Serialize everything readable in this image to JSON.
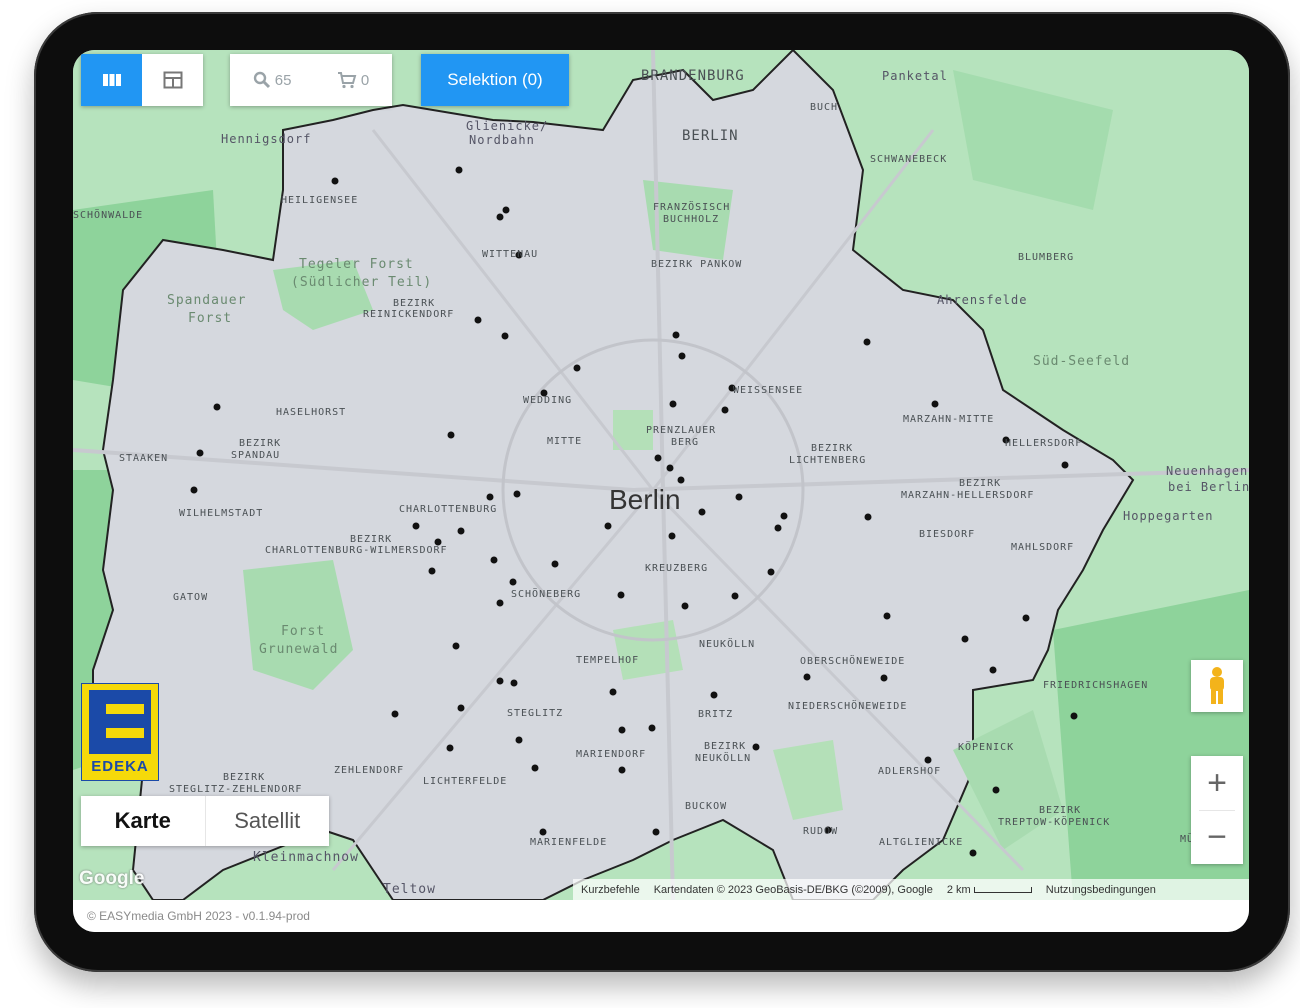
{
  "toolbar": {
    "search_count": "65",
    "cart_count": "0",
    "selection_label": "Selektion (0)"
  },
  "map": {
    "city_label": "Berlin",
    "labels": [
      "BRANDENBURG",
      "Panketal",
      "BERLIN",
      "Glienicke/ Nordbahn",
      "BUCH",
      "Hennigsdorf",
      "SCHWANEBECK",
      "HEILIGENSEE",
      "SCHÖNWALDE",
      "FRANZÖSISCH BUCHHOLZ",
      "BLUMBERG",
      "WITTENAU",
      "BEZIRK PANKOW",
      "Tegeler Forst (Südlicher Teil)",
      "Spandauer Forst",
      "BEZIRK REINICKENDORF",
      "Ahrensfelde",
      "Süd-Seefeld",
      "WEISSENSEE",
      "WEDDING",
      "HASELHORST",
      "MARZAHN-MITTE",
      "MITTE",
      "PRENZLAUER BERG",
      "BEZIRK SPANDAU",
      "STAAKEN",
      "HELLERSDORF",
      "BEZIRK LICHTENBERG",
      "Neuenhagen bei Berlin",
      "BEZIRK MARZAHN-HELLERSDORF",
      "WILHELMSTADT",
      "CHARLOTTENBURG",
      "Hoppegarten",
      "BIESDORF",
      "BEZIRK CHARLOTTENBURG-WILMERSDORF",
      "MAHLSDORF",
      "KREUZBERG",
      "GATOW",
      "SCHÖNEBERG",
      "Forst Grunewald",
      "NEUKÖLLN",
      "TEMPELHOF",
      "OBERSCHÖNEWEIDE",
      "FRIEDRICHSHAGEN",
      "STEGLITZ",
      "BRITZ",
      "NIEDERSCHÖNEWEIDE",
      "MARIENDORF",
      "BEZIRK NEUKÖLLN",
      "KÖPENICK",
      "BEZIRK STEGLITZ-ZEHLENDORF",
      "ZEHLENDORF",
      "ADLERSHOF",
      "LICHTERFELDE",
      "BUCKOW",
      "BEZIRK TREPTOW-KÖPENICK",
      "MÜGGELH",
      "RUDOW",
      "Kleinmachnow",
      "MARIENFELDE",
      "ALTGLIENICKE",
      "Teltow"
    ],
    "attribution": {
      "shortcuts": "Kurzbefehle",
      "data": "Kartendaten © 2023 GeoBasis-DE/BKG (©2009), Google",
      "scale": "2 km",
      "terms": "Nutzungsbedingungen"
    },
    "google_logo": "Google"
  },
  "map_type": {
    "options": [
      "Karte",
      "Satellit"
    ],
    "selected": "Karte"
  },
  "zoom": {
    "in": "+",
    "out": "−"
  },
  "logo": {
    "word": "EDEKA"
  },
  "footer": {
    "text": "© EASYmedia GmbH 2023 - v0.1.94-prod"
  },
  "colors": {
    "accent": "#2196f3",
    "edeka_yellow": "#f5d90a",
    "edeka_blue": "#1b4aa8",
    "map_green": "#8ed39b"
  }
}
